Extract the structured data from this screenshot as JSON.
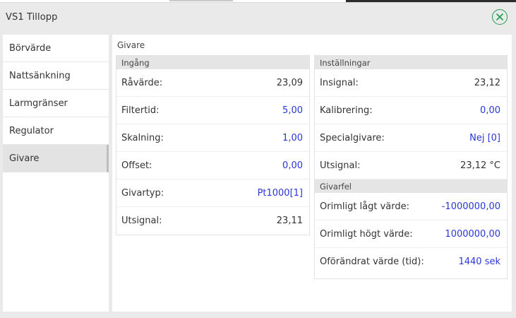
{
  "dialog": {
    "title": "VS1 Tillopp"
  },
  "sidebar": {
    "items": [
      {
        "label": "Börvärde"
      },
      {
        "label": "Nattsänkning"
      },
      {
        "label": "Larmgränser"
      },
      {
        "label": "Regulator"
      },
      {
        "label": "Givare"
      }
    ],
    "active": "Givare"
  },
  "main": {
    "section_title": "Givare",
    "ingang": {
      "title": "Ingång",
      "rows": [
        {
          "label": "Råvärde:",
          "value": "23,09",
          "editable": false
        },
        {
          "label": "Filtertid:",
          "value": "5,00",
          "editable": true
        },
        {
          "label": "Skalning:",
          "value": "1,00",
          "editable": true
        },
        {
          "label": "Offset:",
          "value": "0,00",
          "editable": true
        },
        {
          "label": "Givartyp:",
          "value": "Pt1000[1]",
          "editable": true
        },
        {
          "label": "Utsignal:",
          "value": "23,11",
          "editable": false
        }
      ]
    },
    "installningar": {
      "title": "Inställningar",
      "rows": [
        {
          "label": "Insignal:",
          "value": "23,12",
          "editable": false
        },
        {
          "label": "Kalibrering:",
          "value": "0,00",
          "editable": true
        },
        {
          "label": "Specialgivare:",
          "value": "Nej [0]",
          "editable": true
        },
        {
          "label": "Utsignal:",
          "value": "23,12 °C",
          "editable": false
        }
      ]
    },
    "givarfel": {
      "title": "Givarfel",
      "rows": [
        {
          "label": "Orimligt lågt värde:",
          "value": "-1000000,00",
          "editable": true
        },
        {
          "label": "Orimligt högt värde:",
          "value": "1000000,00",
          "editable": true
        },
        {
          "label": "Oförändrat värde (tid):",
          "value": "1440 sek",
          "editable": true
        }
      ]
    }
  },
  "colors": {
    "editable_value": "#2a36d8",
    "close_icon": "#1e9d4c",
    "panel_header_bg": "#e5e5e5",
    "active_item_bg": "#e3e3e3"
  }
}
